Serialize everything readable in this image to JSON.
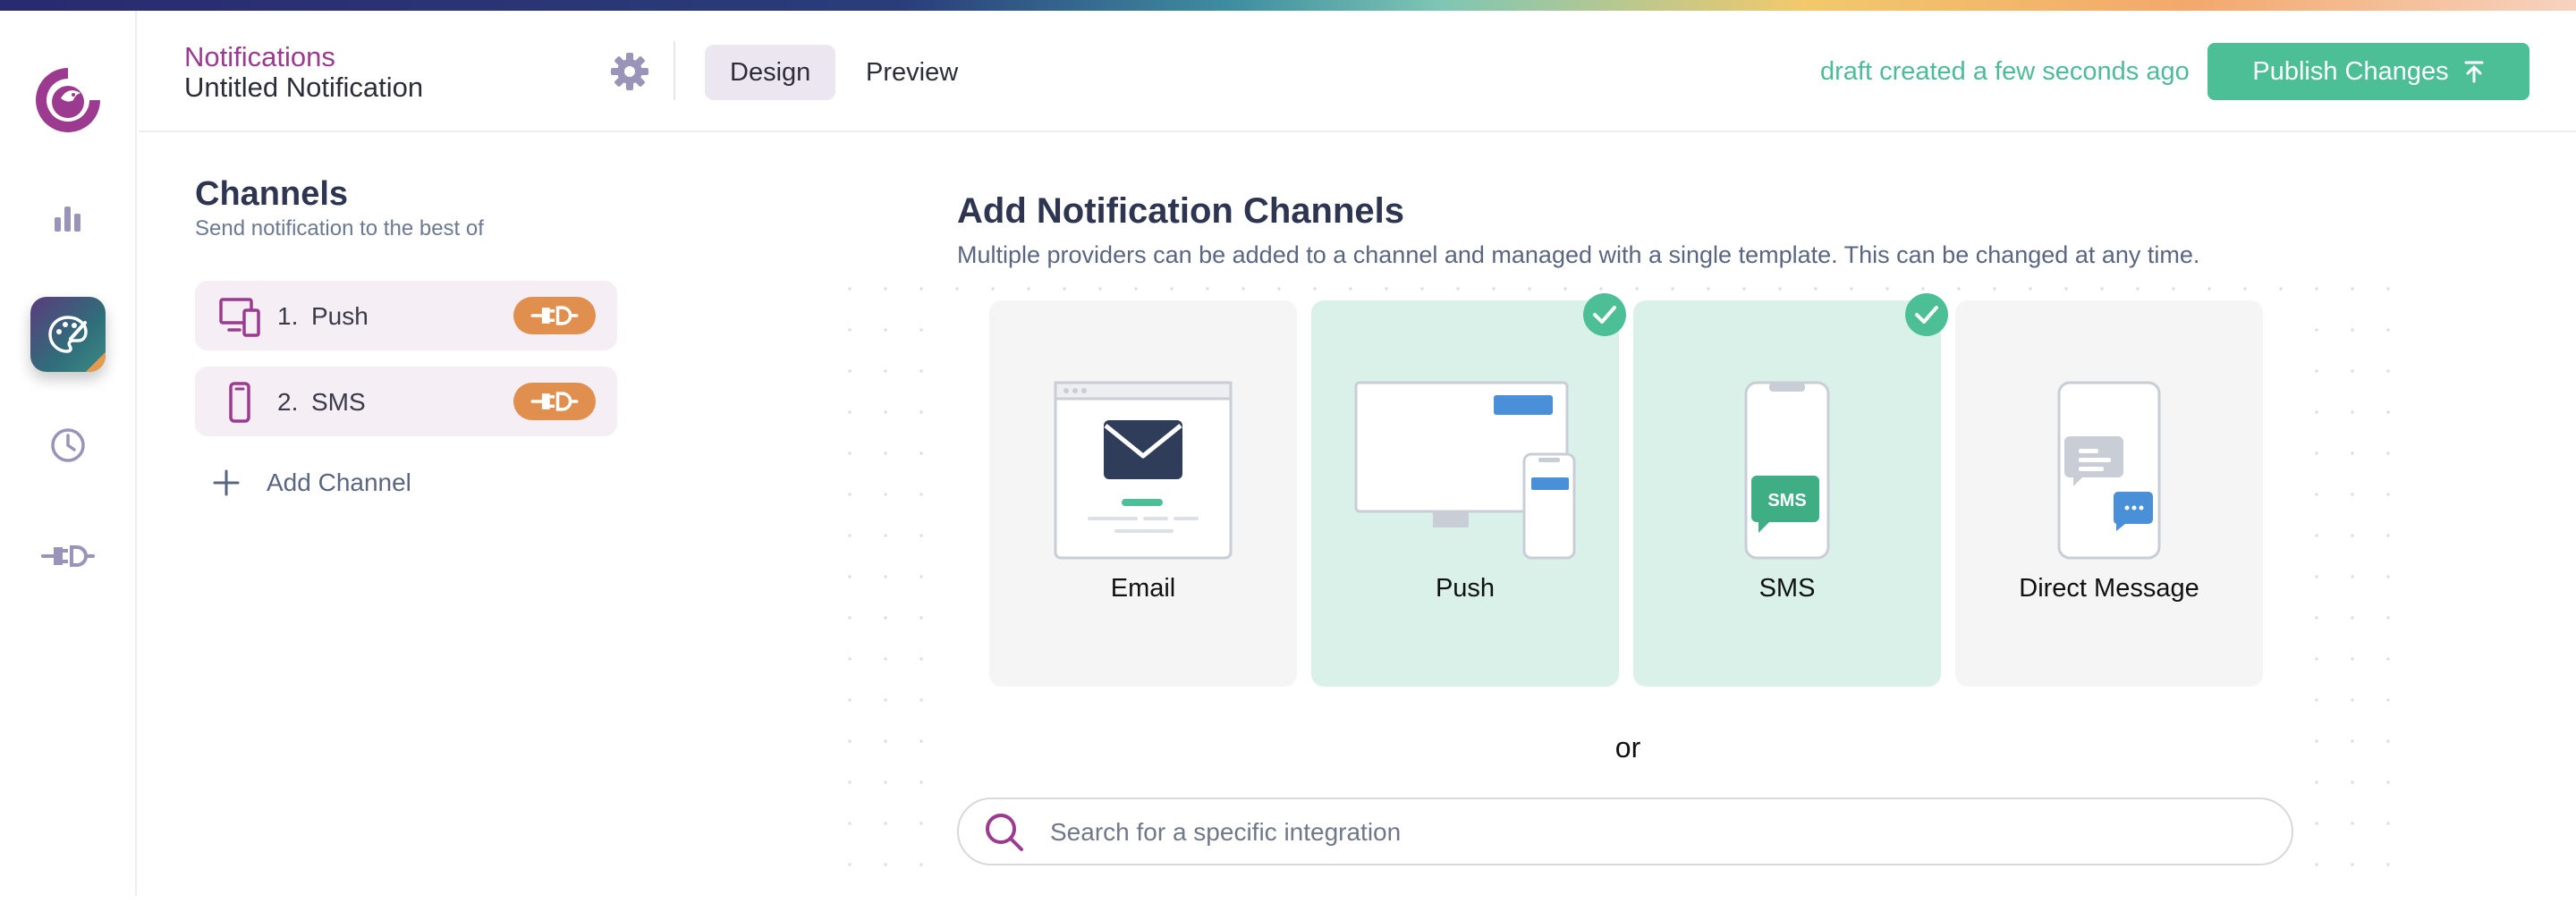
{
  "header": {
    "section": "Notifications",
    "title": "Untitled Notification",
    "tabs": [
      {
        "label": "Design",
        "active": true
      },
      {
        "label": "Preview",
        "active": false
      }
    ],
    "draft_status": "draft created a few seconds ago",
    "publish_label": "Publish Changes"
  },
  "rail": {
    "items": [
      {
        "icon": "bar-chart-icon",
        "active": false
      },
      {
        "icon": "palette-icon",
        "active": true
      },
      {
        "icon": "clock-icon",
        "active": false
      },
      {
        "icon": "plug-icon",
        "active": false
      }
    ]
  },
  "channels": {
    "title": "Channels",
    "subtitle": "Send notification to the best of",
    "items": [
      {
        "number": "1.",
        "label": "Push",
        "icon": "devices-icon"
      },
      {
        "number": "2.",
        "label": "SMS",
        "icon": "phone-icon"
      }
    ],
    "add_label": "Add Channel"
  },
  "main": {
    "title": "Add Notification Channels",
    "subtitle": "Multiple providers can be added to a channel and managed with a single template. This can be changed at any time.",
    "cards": [
      {
        "label": "Email",
        "selected": false
      },
      {
        "label": "Push",
        "selected": true
      },
      {
        "label": "SMS",
        "selected": true
      },
      {
        "label": "Direct Message",
        "selected": false
      }
    ],
    "sms_badge": "SMS",
    "or_text": "or",
    "search_placeholder": "Search for a specific integration"
  },
  "colors": {
    "accent_green": "#4dbf97",
    "brand_purple": "#9b3a8f",
    "plug_orange": "#e08f4e"
  }
}
